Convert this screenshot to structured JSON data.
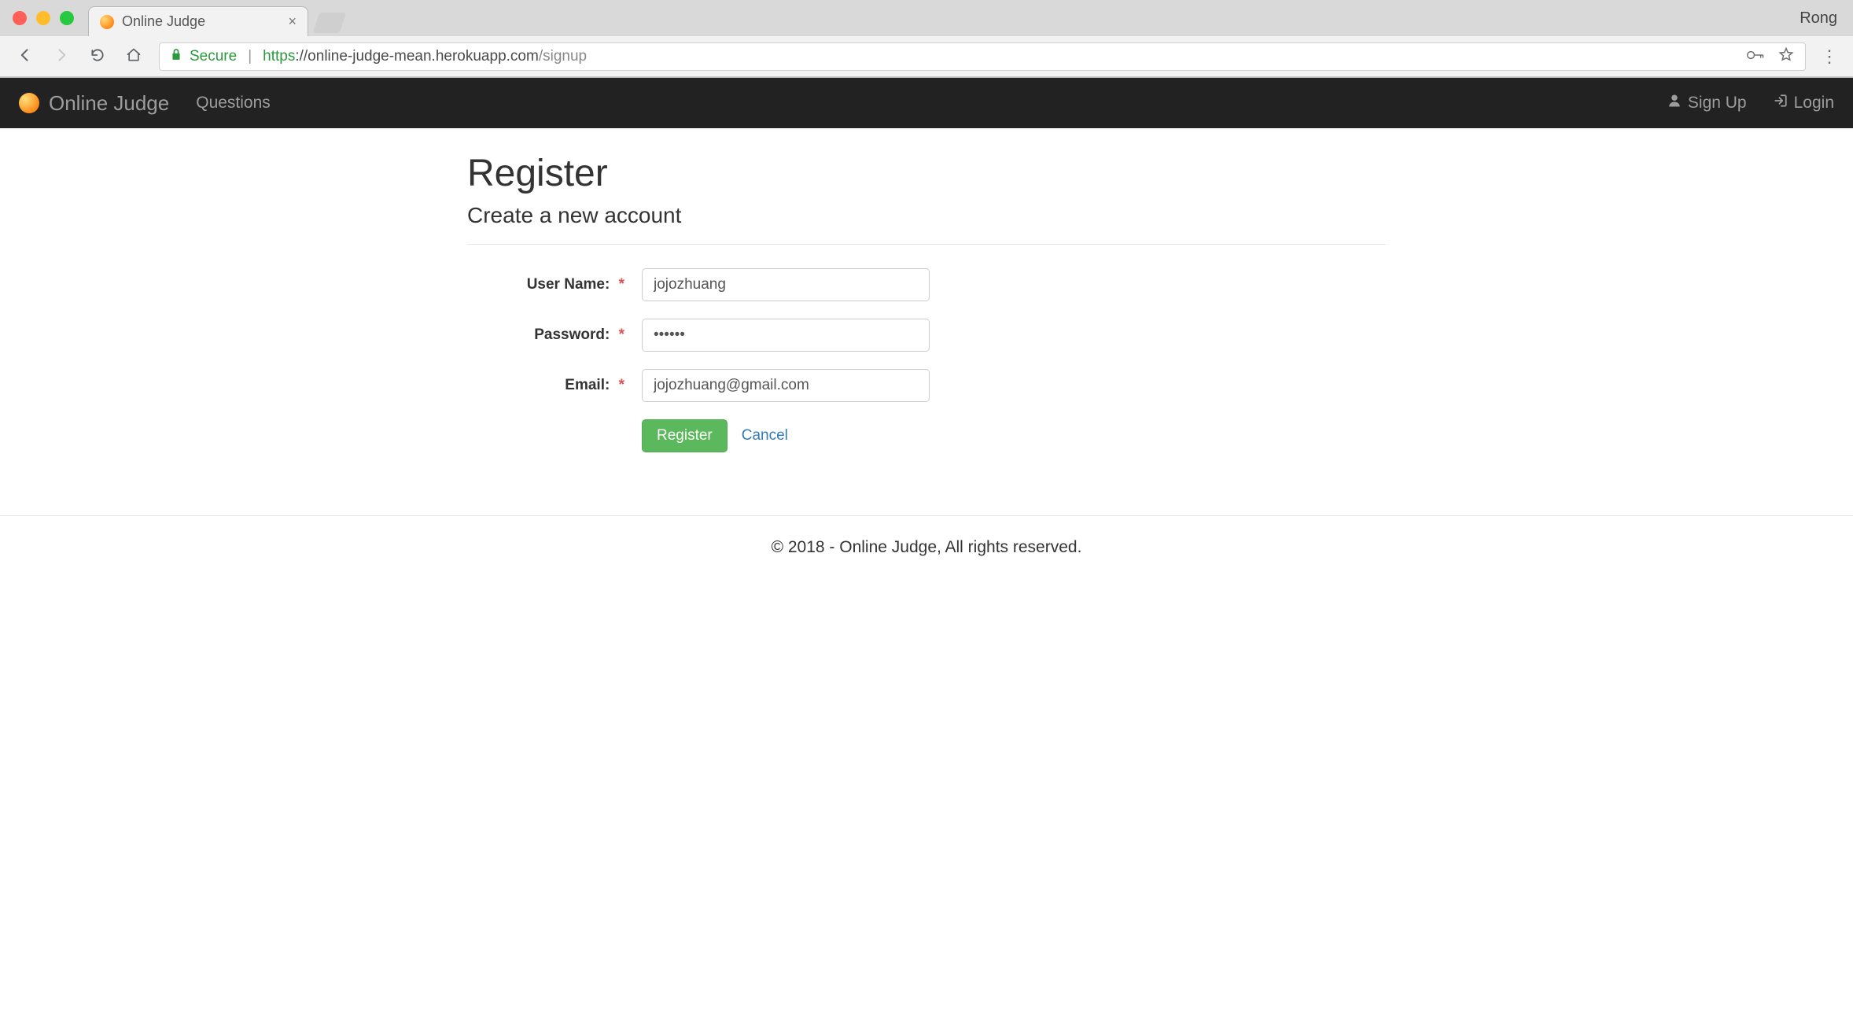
{
  "browser": {
    "profile_name": "Rong",
    "tab": {
      "title": "Online Judge"
    },
    "address": {
      "secure_label": "Secure",
      "scheme": "https",
      "host_and_path": "://online-judge-mean.herokuapp.com",
      "path": "/signup"
    }
  },
  "navbar": {
    "brand": "Online Judge",
    "links": {
      "questions": "Questions"
    },
    "right": {
      "signup": "Sign Up",
      "login": "Login"
    }
  },
  "page": {
    "title": "Register",
    "subtitle": "Create a new account",
    "form": {
      "username_label": "User Name:",
      "username_value": "jojozhuang",
      "password_label": "Password:",
      "password_value": "••••••",
      "email_label": "Email:",
      "email_value": "jojozhuang@gmail.com",
      "required_marker": "*",
      "register_label": "Register",
      "cancel_label": "Cancel"
    }
  },
  "footer": {
    "text": "© 2018 - Online Judge, All rights reserved."
  }
}
